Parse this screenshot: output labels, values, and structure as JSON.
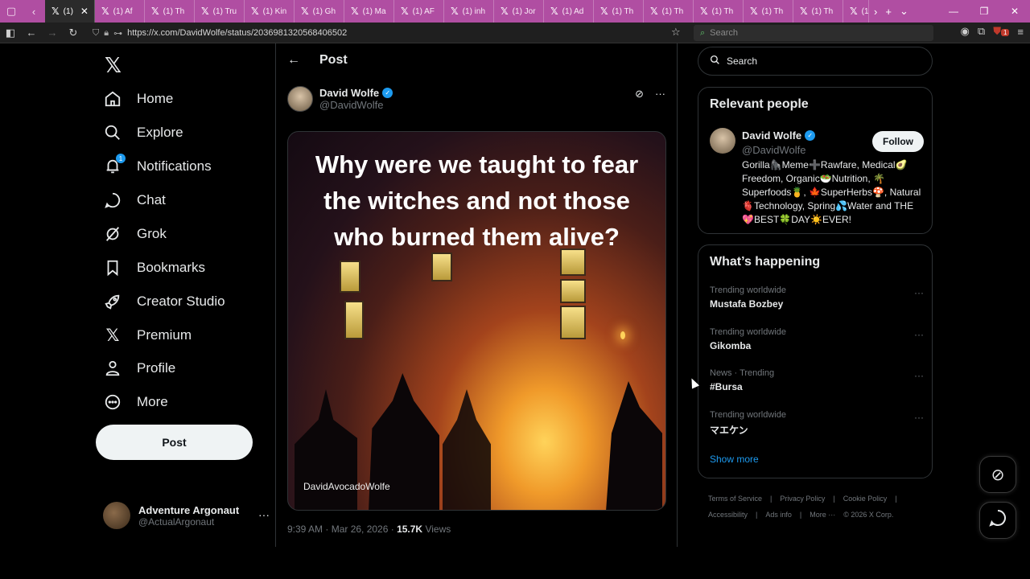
{
  "browser": {
    "tabs": [
      "(1)",
      "(1) Af",
      "(1) Th",
      "(1) Tru",
      "(1) Kin",
      "(1) Gh",
      "(1) Ma",
      "(1) AF",
      "(1) inh",
      "(1) Jor",
      "(1) Ad",
      "(1) Th",
      "(1) Th",
      "(1) Th",
      "(1) Th",
      "(1) Th",
      "(1"
    ],
    "url": "https://x.com/DavidWolfe/status/2036981320568406502",
    "search_placeholder": "Search",
    "ext_badge": "1"
  },
  "sidebar": {
    "items": [
      {
        "label": "Home",
        "icon": "home-icon"
      },
      {
        "label": "Explore",
        "icon": "search-icon"
      },
      {
        "label": "Notifications",
        "icon": "bell-icon"
      },
      {
        "label": "Chat",
        "icon": "chat-icon"
      },
      {
        "label": "Grok",
        "icon": "grok-icon"
      },
      {
        "label": "Bookmarks",
        "icon": "bookmark-icon"
      },
      {
        "label": "Creator Studio",
        "icon": "rocket-icon"
      },
      {
        "label": "Premium",
        "icon": "x-icon"
      },
      {
        "label": "Profile",
        "icon": "person-icon"
      },
      {
        "label": "More",
        "icon": "more-circle-icon"
      }
    ],
    "notif_count": "1",
    "post_label": "Post",
    "account": {
      "name": "Adventure Argonaut",
      "handle": "@ActualArgonaut"
    }
  },
  "post": {
    "header_title": "Post",
    "author_name": "David Wolfe",
    "author_handle": "@DavidWolfe",
    "image_caption": "Why were we taught to fear the witches and not those who burned them alive?",
    "image_watermark": "DavidAvocadoWolfe",
    "time": "9:39 AM · Mar 26, 2026 · ",
    "views_count": "15.7K",
    "views_label": " Views"
  },
  "right": {
    "search_placeholder": "Search",
    "relevant_title": "Relevant people",
    "person": {
      "name": "David Wolfe",
      "handle": "@DavidWolfe",
      "follow_label": "Follow",
      "bio": "Gorilla🦍Meme➕Rawfare, Medical🥑Freedom, Organic🥗Nutrition, 🌴Superfoods🍍, 🍁SuperHerbs🍄, Natural🫀Technology, Spring💦Water and THE💖BEST🍀DAY☀️EVER!"
    },
    "happening_title": "What’s happening",
    "trends": [
      {
        "context": "Trending worldwide",
        "title": "Mustafa Bozbey"
      },
      {
        "context": "Trending worldwide",
        "title": "Gikomba"
      },
      {
        "context": "News · Trending",
        "title": "#Bursa"
      },
      {
        "context": "Trending worldwide",
        "title": "マエケン"
      }
    ],
    "show_more": "Show more",
    "footer": [
      "Terms of Service",
      "|",
      "Privacy Policy",
      "|",
      "Cookie Policy",
      "|",
      "Accessibility",
      "|",
      "Ads info",
      "|",
      "More ···",
      "© 2026 X Corp."
    ]
  },
  "colors": {
    "accent": "#1d9bf0",
    "background": "#000000",
    "tabbar": "#b04ea2"
  }
}
